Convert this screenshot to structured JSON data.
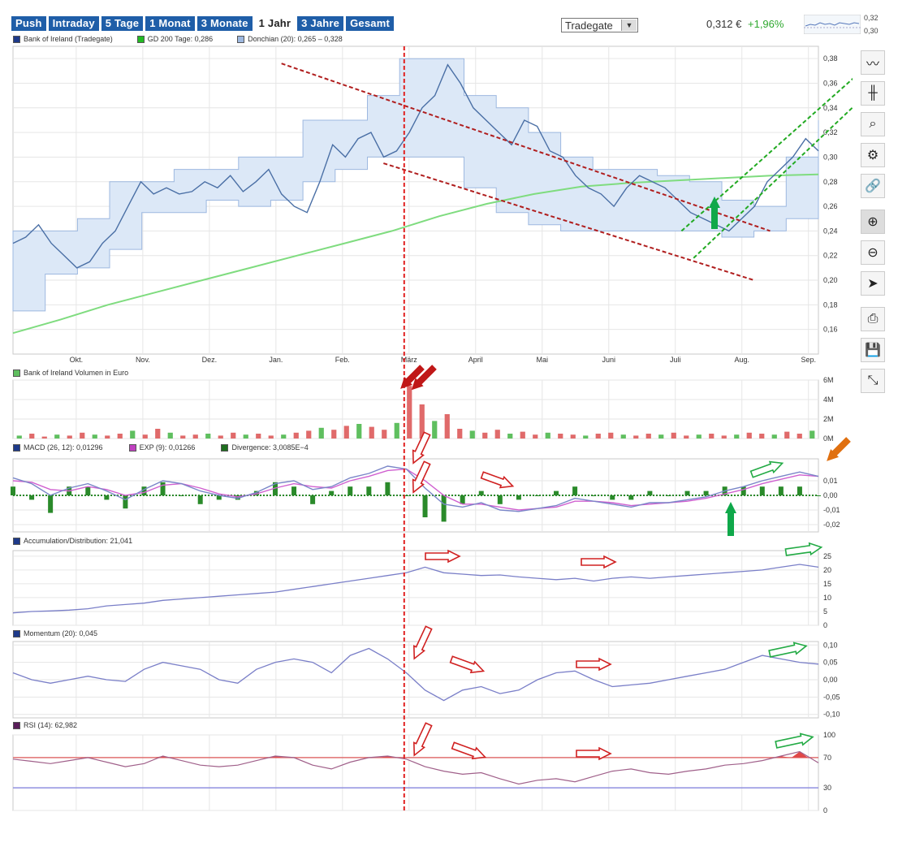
{
  "tabs": [
    {
      "label": "Push",
      "active": false
    },
    {
      "label": "Intraday",
      "active": false
    },
    {
      "label": "5 Tage",
      "active": false
    },
    {
      "label": "1 Monat",
      "active": false
    },
    {
      "label": "3 Monate",
      "active": false
    },
    {
      "label": "1 Jahr",
      "active": true
    },
    {
      "label": "3 Jahre",
      "active": false
    },
    {
      "label": "Gesamt",
      "active": false
    }
  ],
  "exchange": {
    "selected": "Tradegate"
  },
  "quote": {
    "price": "0,312 €",
    "change": "+1,96%",
    "change_color": "#2fa82f",
    "mini_chart_labels": [
      "0,32",
      "0,30"
    ]
  },
  "legend": {
    "price": {
      "label": "Bank of Ireland (Tradegate)",
      "color": "#1e3a8a"
    },
    "sma": {
      "label": "GD 200 Tage: 0,286",
      "color": "#22bb22"
    },
    "donchian": {
      "label": "Donchian (20): 0,265 – 0,328",
      "color": "#9db8e0"
    }
  },
  "panels": {
    "volume": {
      "label": "Bank of Ireland Volumen in Euro",
      "color": "#5fbf5f"
    },
    "macd": {
      "labels": [
        {
          "label": "MACD (26, 12): 0,01296",
          "color": "#1e3a8a"
        },
        {
          "label": "EXP (9): 0,01266",
          "color": "#c040c0"
        },
        {
          "label": "Divergence: 3,0085E−4",
          "color": "#1e6e1e"
        }
      ]
    },
    "ad": {
      "label": "Accumulation/Distribution: 21,041",
      "color": "#1e3a8a"
    },
    "momentum": {
      "label": "Momentum (20): 0,045",
      "color": "#1e3a8a"
    },
    "rsi": {
      "label": "RSI (14): 62,982",
      "color": "#5a1e5a"
    }
  },
  "toolbar": [
    {
      "name": "line-chart-icon",
      "glyph": "〰"
    },
    {
      "name": "ohlc-chart-icon",
      "glyph": "╫"
    },
    {
      "name": "indicator-icon",
      "glyph": "⌕"
    },
    {
      "name": "settings-icon",
      "glyph": "⚙"
    },
    {
      "name": "link-icon",
      "glyph": "🔗"
    },
    {
      "name": "zoom-in-icon",
      "glyph": "⊕"
    },
    {
      "name": "zoom-out-icon",
      "glyph": "⊖"
    },
    {
      "name": "pointer-icon",
      "glyph": "➤"
    },
    {
      "name": "print-icon",
      "glyph": "⎙"
    },
    {
      "name": "save-icon",
      "glyph": "💾"
    },
    {
      "name": "fullscreen-icon",
      "glyph": "⤡"
    }
  ],
  "chart_data": {
    "type": "line",
    "months": [
      "Okt.",
      "Nov.",
      "Dez.",
      "Jan.",
      "Feb.",
      "März",
      "April",
      "Mai",
      "Juni",
      "Juli",
      "Aug.",
      "Sep."
    ],
    "price": {
      "ylim": [
        0.14,
        0.39
      ],
      "yticks": [
        "0,16",
        "0,18",
        "0,20",
        "0,22",
        "0,24",
        "0,26",
        "0,28",
        "0,30",
        "0,32",
        "0,34",
        "0,36",
        "0,38"
      ],
      "close": [
        0.23,
        0.235,
        0.245,
        0.23,
        0.22,
        0.21,
        0.215,
        0.23,
        0.24,
        0.26,
        0.28,
        0.27,
        0.275,
        0.27,
        0.272,
        0.28,
        0.275,
        0.285,
        0.272,
        0.28,
        0.29,
        0.27,
        0.26,
        0.255,
        0.28,
        0.31,
        0.3,
        0.315,
        0.32,
        0.3,
        0.305,
        0.32,
        0.34,
        0.35,
        0.375,
        0.36,
        0.34,
        0.33,
        0.32,
        0.31,
        0.33,
        0.325,
        0.305,
        0.3,
        0.285,
        0.275,
        0.27,
        0.26,
        0.275,
        0.285,
        0.28,
        0.275,
        0.265,
        0.255,
        0.25,
        0.245,
        0.24,
        0.25,
        0.26,
        0.28,
        0.29,
        0.3,
        0.315,
        0.305
      ],
      "sma200": [
        0.157,
        0.168,
        0.18,
        0.19,
        0.2,
        0.21,
        0.22,
        0.23,
        0.24,
        0.252,
        0.262,
        0.27,
        0.276,
        0.279,
        0.281,
        0.283,
        0.285,
        0.286
      ],
      "donchian_upper": [
        0.24,
        0.24,
        0.25,
        0.28,
        0.28,
        0.29,
        0.29,
        0.3,
        0.3,
        0.33,
        0.33,
        0.35,
        0.38,
        0.38,
        0.35,
        0.34,
        0.32,
        0.3,
        0.29,
        0.29,
        0.285,
        0.28,
        0.265,
        0.26,
        0.3,
        0.33
      ],
      "donchian_lower": [
        0.175,
        0.205,
        0.21,
        0.225,
        0.255,
        0.255,
        0.265,
        0.26,
        0.265,
        0.28,
        0.29,
        0.3,
        0.3,
        0.3,
        0.275,
        0.255,
        0.245,
        0.24,
        0.24,
        0.24,
        0.24,
        0.24,
        0.235,
        0.24,
        0.25,
        0.265
      ]
    },
    "volume": {
      "ylim": [
        0,
        6000000
      ],
      "yticks": [
        "0M",
        "2M",
        "4M",
        "6M"
      ],
      "bars": [
        0.3,
        0.5,
        0.2,
        0.4,
        0.3,
        0.6,
        0.4,
        0.3,
        0.5,
        0.8,
        0.4,
        1.0,
        0.6,
        0.3,
        0.4,
        0.5,
        0.3,
        0.6,
        0.4,
        0.5,
        0.3,
        0.4,
        0.6,
        0.8,
        1.1,
        0.9,
        1.3,
        1.5,
        1.2,
        0.9,
        1.6,
        5.4,
        3.5,
        1.8,
        2.5,
        1.0,
        0.8,
        0.6,
        0.9,
        0.5,
        0.7,
        0.4,
        0.6,
        0.5,
        0.4,
        0.3,
        0.5,
        0.6,
        0.4,
        0.3,
        0.5,
        0.4,
        0.6,
        0.3,
        0.4,
        0.5,
        0.3,
        0.4,
        0.6,
        0.5,
        0.4,
        0.7,
        0.5,
        0.8
      ]
    },
    "macd": {
      "ylim": [
        -0.025,
        0.025
      ],
      "yticks": [
        "0,01",
        "0,00",
        "-0,01",
        "-0,02"
      ],
      "macd": [
        0.012,
        0.008,
        0.0,
        0.005,
        0.008,
        0.003,
        -0.003,
        0.004,
        0.01,
        0.008,
        0.003,
        0.0,
        -0.002,
        0.002,
        0.008,
        0.01,
        0.004,
        0.006,
        0.012,
        0.015,
        0.02,
        0.018,
        0.005,
        -0.006,
        -0.008,
        -0.005,
        -0.01,
        -0.011,
        -0.009,
        -0.007,
        -0.002,
        -0.004,
        -0.006,
        -0.008,
        -0.005,
        -0.005,
        -0.003,
        -0.001,
        0.003,
        0.006,
        0.01,
        0.013,
        0.016,
        0.013
      ],
      "signal": [
        0.01,
        0.009,
        0.004,
        0.003,
        0.006,
        0.004,
        0.0,
        0.002,
        0.007,
        0.008,
        0.005,
        0.001,
        -0.001,
        0.001,
        0.005,
        0.008,
        0.006,
        0.005,
        0.01,
        0.013,
        0.017,
        0.018,
        0.01,
        0.0,
        -0.006,
        -0.006,
        -0.008,
        -0.01,
        -0.009,
        -0.008,
        -0.004,
        -0.004,
        -0.005,
        -0.007,
        -0.006,
        -0.005,
        -0.004,
        -0.002,
        0.001,
        0.004,
        0.008,
        0.011,
        0.014,
        0.013
      ]
    },
    "ad": {
      "ylim": [
        0,
        27
      ],
      "yticks": [
        "25",
        "20",
        "15",
        "10",
        "5",
        "0"
      ],
      "values": [
        4.5,
        5,
        5.2,
        5.5,
        6,
        7,
        7.5,
        8,
        9,
        9.5,
        10,
        10.5,
        11,
        11.5,
        12,
        13,
        14,
        15,
        16,
        17,
        18,
        19,
        21,
        19,
        18.5,
        18,
        18.2,
        17.5,
        17,
        16.5,
        17,
        16,
        17,
        17.5,
        17,
        17.5,
        18,
        18.5,
        19,
        19.5,
        20,
        21,
        22,
        21
      ]
    },
    "momentum": {
      "ylim": [
        -0.11,
        0.11
      ],
      "yticks": [
        "0,10",
        "0,05",
        "0,00",
        "-0,05",
        "-0,10"
      ],
      "values": [
        0.02,
        0.0,
        -0.01,
        0.0,
        0.01,
        0.0,
        -0.005,
        0.03,
        0.05,
        0.04,
        0.03,
        0.0,
        -0.01,
        0.03,
        0.05,
        0.06,
        0.05,
        0.02,
        0.07,
        0.09,
        0.06,
        0.02,
        -0.03,
        -0.06,
        -0.03,
        -0.02,
        -0.04,
        -0.03,
        0.0,
        0.02,
        0.025,
        0.0,
        -0.02,
        -0.015,
        -0.01,
        0.0,
        0.01,
        0.02,
        0.03,
        0.05,
        0.07,
        0.06,
        0.05,
        0.045
      ]
    },
    "rsi": {
      "ylim": [
        0,
        100
      ],
      "yticks": [
        "100",
        "70",
        "30",
        "0"
      ],
      "levels": [
        30,
        70
      ],
      "values": [
        68,
        65,
        62,
        66,
        70,
        64,
        58,
        62,
        72,
        66,
        60,
        58,
        60,
        66,
        72,
        70,
        60,
        55,
        64,
        70,
        72,
        68,
        58,
        52,
        48,
        50,
        42,
        35,
        40,
        42,
        38,
        45,
        52,
        55,
        50,
        48,
        52,
        55,
        60,
        62,
        66,
        72,
        78,
        63
      ]
    },
    "annotations": {
      "vertical_marker_month": "März",
      "downtrend": [
        [
          0.376,
          0.24
        ],
        [
          0.2,
          0.295
        ]
      ],
      "uptrend": [
        [
          0.24,
          0.328
        ],
        [
          0.218,
          0.302
        ]
      ]
    }
  }
}
